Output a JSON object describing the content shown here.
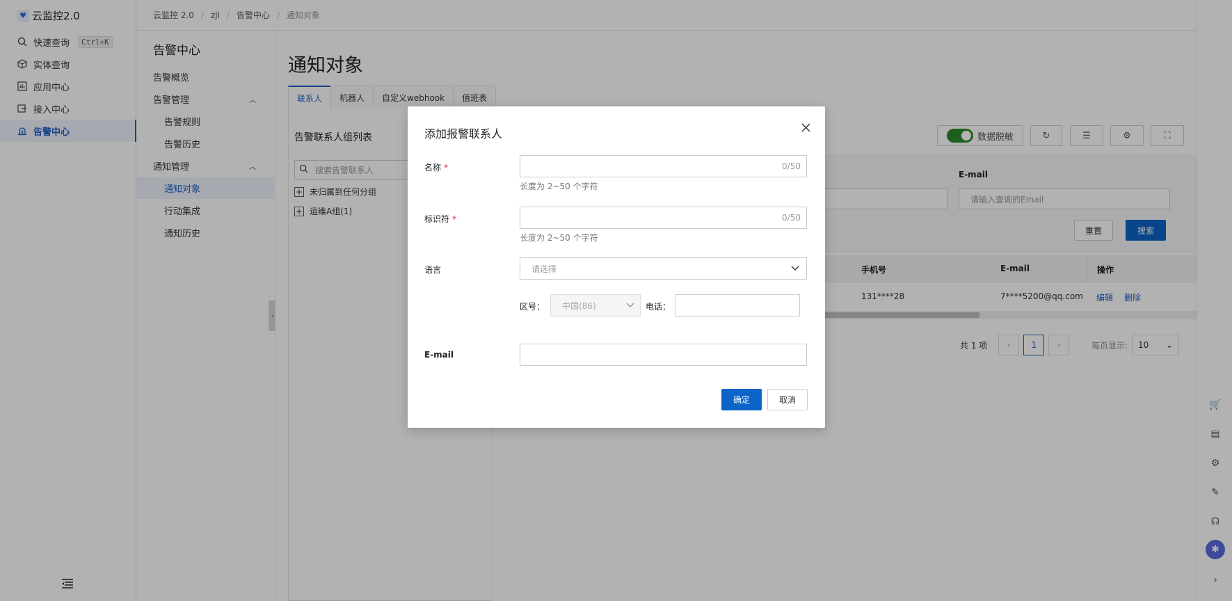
{
  "app": {
    "title": "云监控2.0",
    "logo_icon": "shield-logo-icon"
  },
  "leftnav": {
    "items": [
      {
        "label": "快速查询",
        "shortcut": "Ctrl+K",
        "icon": "search-icon"
      },
      {
        "label": "实体查询",
        "icon": "cube-icon"
      },
      {
        "label": "应用中心",
        "icon": "chart-icon"
      },
      {
        "label": "接入中心",
        "icon": "plug-icon"
      },
      {
        "label": "告警中心",
        "icon": "alarm-icon",
        "active": true
      }
    ],
    "collapse_icon": "menu-collapse-icon"
  },
  "breadcrumb": [
    "云监控 2.0",
    "zjl",
    "告警中心",
    "通知对象"
  ],
  "submenu": {
    "title": "告警中心",
    "items": [
      {
        "label": "告警概览",
        "type": "item"
      },
      {
        "label": "告警管理",
        "type": "group"
      },
      {
        "label": "告警规则",
        "type": "child"
      },
      {
        "label": "告警历史",
        "type": "child"
      },
      {
        "label": "通知管理",
        "type": "group"
      },
      {
        "label": "通知对象",
        "type": "child",
        "active": true
      },
      {
        "label": "行动集成",
        "type": "child"
      },
      {
        "label": "通知历史",
        "type": "child"
      }
    ]
  },
  "main": {
    "title": "通知对象",
    "tabs": [
      "联系人",
      "机器人",
      "自定义webhook",
      "值班表"
    ],
    "active_tab": 0,
    "group_panel": {
      "title": "告警联系人组列表",
      "search_placeholder": "搜索告警联系人",
      "tree": [
        "未归属到任何分组",
        "运维A组(1)"
      ]
    },
    "toolbar": {
      "mask_label": "数据脱敏",
      "mask_on": true
    },
    "filter": {
      "email_label": "E-mail",
      "email_placeholder": "请输入查询的Email",
      "reset_label": "重置",
      "search_label": "搜索"
    },
    "table": {
      "headers": {
        "phone": "手机号",
        "email": "E-mail",
        "ops": "操作"
      },
      "rows": [
        {
          "phone": "131****28",
          "email": "7****5200@qq.com",
          "edit": "编辑",
          "delete": "删除"
        }
      ]
    },
    "pager": {
      "total": "共 1 项",
      "current": "1",
      "per_page_label": "每页显示:",
      "per_page": "10"
    }
  },
  "modal": {
    "title": "添加报警联系人",
    "name_label": "名称",
    "name_count": "0/50",
    "name_help": "长度为 2~50 个字符",
    "id_label": "标识符",
    "id_count": "0/50",
    "id_help": "长度为 2~50 个字符",
    "lang_label": "语言",
    "lang_placeholder": "请选择",
    "area_label": "区号：",
    "area_value": "中国(86)",
    "phone_label": "电话：",
    "email_label": "E-mail",
    "confirm_label": "确定",
    "cancel_label": "取消"
  },
  "colors": {
    "accent": "#1f5fc4",
    "primary_button": "#0c64c8",
    "required": "#e0282e",
    "toggle_on": "#2a8a2a"
  }
}
